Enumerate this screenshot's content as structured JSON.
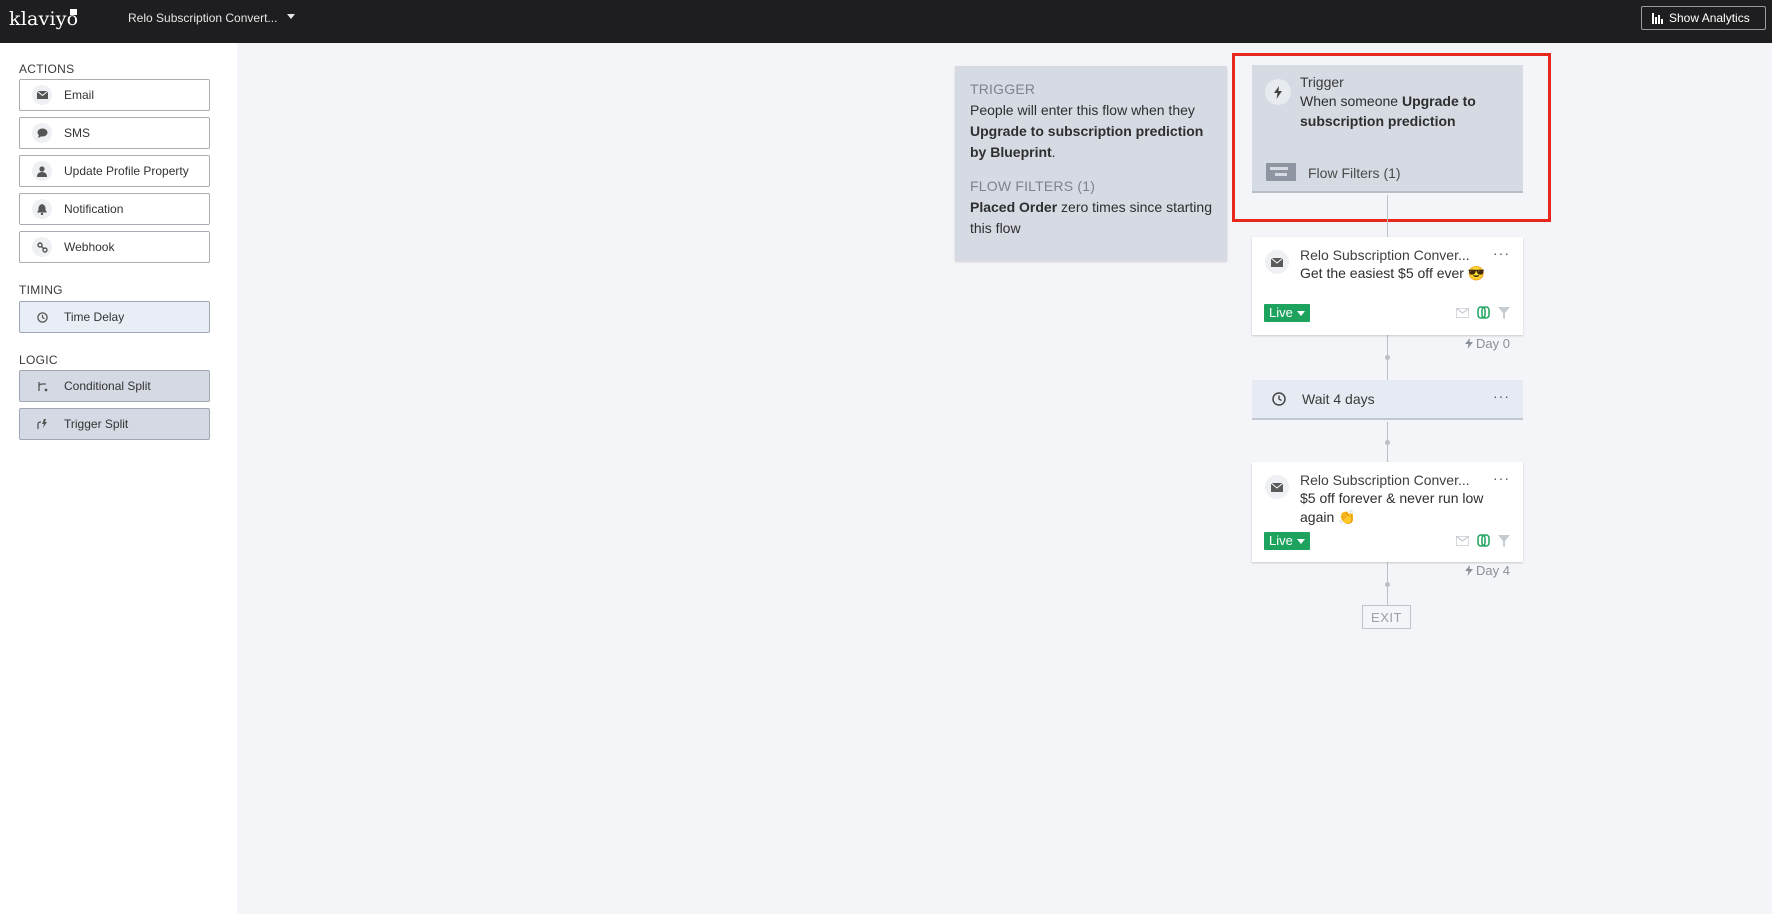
{
  "app": {
    "logo": "klaviyo",
    "flow_name": "Relo Subscription Convert...",
    "analytics_label": "Show Analytics"
  },
  "sidebar": {
    "actions_label": "ACTIONS",
    "actions": [
      {
        "label": "Email",
        "icon": "envelope-icon"
      },
      {
        "label": "SMS",
        "icon": "chat-bubble-icon"
      },
      {
        "label": "Update Profile Property",
        "icon": "person-icon"
      },
      {
        "label": "Notification",
        "icon": "bell-icon"
      },
      {
        "label": "Webhook",
        "icon": "webhook-icon"
      }
    ],
    "timing_label": "TIMING",
    "timing": [
      {
        "label": "Time Delay",
        "icon": "clock-icon"
      }
    ],
    "logic_label": "LOGIC",
    "logic": [
      {
        "label": "Conditional Split",
        "icon": "split-icon"
      },
      {
        "label": "Trigger Split",
        "icon": "trigger-split-icon"
      }
    ]
  },
  "info_panel": {
    "trigger_heading": "TRIGGER",
    "trigger_text_1": "People will enter this flow when they ",
    "trigger_bold_1": "Upgrade to subscription prediction by Blueprint",
    "trigger_text_2": ".",
    "filters_heading": "FLOW FILTERS (1)",
    "filters_bold": "Placed Order",
    "filters_text": " zero times since starting this flow"
  },
  "trigger_card": {
    "title": "Trigger",
    "desc_prefix": "When someone ",
    "desc_bold": "Upgrade to subscription prediction",
    "filters_label": "Flow Filters (1)"
  },
  "emails": [
    {
      "title": "Relo Subscription Conver...",
      "subject": "Get the easiest $5 off ever 😎",
      "status": "Live",
      "day": "Day 0"
    },
    {
      "title": "Relo Subscription Conver...",
      "subject": "$5 off forever & never run low again 👏",
      "status": "Live",
      "day": "Day 4"
    }
  ],
  "delay": {
    "label": "Wait 4 days"
  },
  "exit_label": "EXIT",
  "more_label": "···",
  "colors": {
    "topbar": "#1e1e20",
    "live_green": "#1da35d",
    "highlight_red": "#e8271d",
    "trigger_card_bg": "#d5dae3",
    "canvas_bg": "#f4f5f9"
  }
}
